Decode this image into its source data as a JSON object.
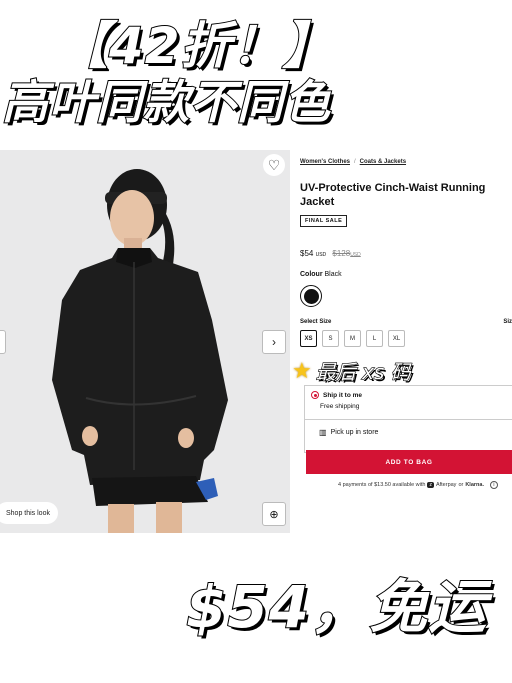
{
  "overlay": {
    "headline_top": "【42折！】",
    "headline_sub": "高叶同款不同色",
    "headline_bottom": "$54，免运",
    "sticker": "最后 xs 码"
  },
  "breadcrumb": {
    "item1": "Women's Clothes",
    "separator": "/",
    "item2": "Coats & Jackets"
  },
  "product": {
    "title": "UV-Protective Cinch-Waist Running Jacket",
    "badge": "FINAL SALE",
    "price": "$54",
    "currency": "USD",
    "original_price": "$128",
    "original_currency": "USD",
    "colour_label": "Colour",
    "colour_value": "Black",
    "swatch_color": "#111111"
  },
  "sizes": {
    "label": "Select Size",
    "guide": "Siz",
    "options": [
      "XS",
      "S",
      "M",
      "L",
      "XL"
    ],
    "selected": "XS"
  },
  "shipping": {
    "ship_label": "Ship it to me",
    "free_label": "Free shipping",
    "pickup_label": "Pick up in store"
  },
  "cta": {
    "add_to_bag": "ADD TO BAG"
  },
  "payments": {
    "text": "4 payments of $13.50 available with",
    "afterpay": "Afterpay",
    "or": "or",
    "klarna": "Klarna."
  },
  "gallery": {
    "shop_look": "Shop this look"
  },
  "colors": {
    "accent": "#d31334",
    "photo_bg": "#e9e9ea"
  }
}
